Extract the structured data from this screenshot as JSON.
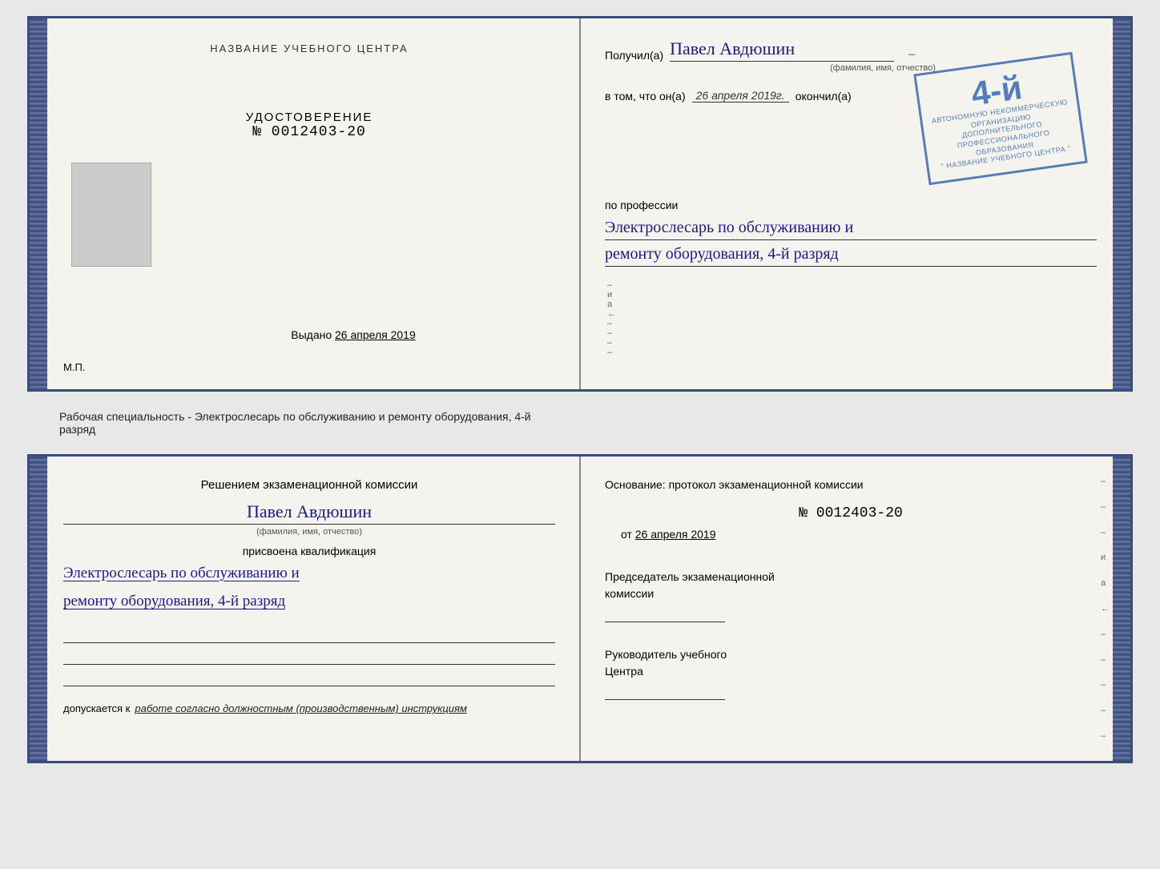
{
  "topDoc": {
    "leftPage": {
      "centerTitle": "НАЗВАНИЕ УЧЕБНОГО ЦЕНТРА",
      "photoPlaceholder": "",
      "docTitle": "УДОСТОВЕРЕНИЕ",
      "docNumber": "№ 0012403-20",
      "issuedLabel": "Выдано",
      "issuedDate": "26 апреля 2019",
      "mpLabel": "М.П."
    },
    "rightPage": {
      "receivedLabel": "Получил(а)",
      "personName": "Павел Авдюшин",
      "fioSubLabel": "(фамилия, имя, отчество)",
      "vtomLabel": "в том, что он(а)",
      "date": "26 апреля 2019г.",
      "okonchilLabel": "окончил(а)",
      "gradeNumber": "4-й",
      "stampLine1": "АВТОНОМНУЮ НЕКОММЕРЧЕСКУЮ ОРГАНИЗАЦИЮ",
      "stampLine2": "ДОПОЛНИТЕЛЬНОГО ПРОФЕССИОНАЛЬНОГО ОБРАЗОВАНИЯ",
      "stampLine3": "\" НАЗВАНИЕ УЧЕБНОГО ЦЕНТРА \"",
      "professionLabel": "по профессии",
      "professionLine1": "Электрослесарь по обслуживанию и",
      "professionLine2": "ремонту оборудования, 4-й разряд"
    }
  },
  "middleText": {
    "line1": "Рабочая специальность - Электрослесарь по обслуживанию и ремонту оборудования, 4-й",
    "line2": "разряд"
  },
  "bottomDoc": {
    "leftPage": {
      "commissionTitle1": "Решением экзаменационной комиссии",
      "personName": "Павел Авдюшин",
      "fioSubLabel": "(фамилия, имя, отчество)",
      "assignedLabel": "присвоена квалификация",
      "qualificationLine1": "Электрослесарь по обслуживанию и",
      "qualificationLine2": "ремонту оборудования, 4-й разряд",
      "допускаетсяLabel": "допускается к",
      "workDescription": "работе согласно должностным (производственным) инструкциям"
    },
    "rightPage": {
      "osnLabel": "Основание: протокол экзаменационной комиссии",
      "protocolNumber": "№ 0012403-20",
      "otLabel": "от",
      "otDate": "26 апреля 2019",
      "chairLabel1": "Председатель экзаменационной",
      "chairLabel2": "комиссии",
      "headLabel1": "Руководитель учебного",
      "headLabel2": "Центра"
    }
  },
  "sideMarks": {
    "marks": [
      "и",
      "а",
      "←",
      "–",
      "–",
      "–",
      "–",
      "–"
    ]
  }
}
